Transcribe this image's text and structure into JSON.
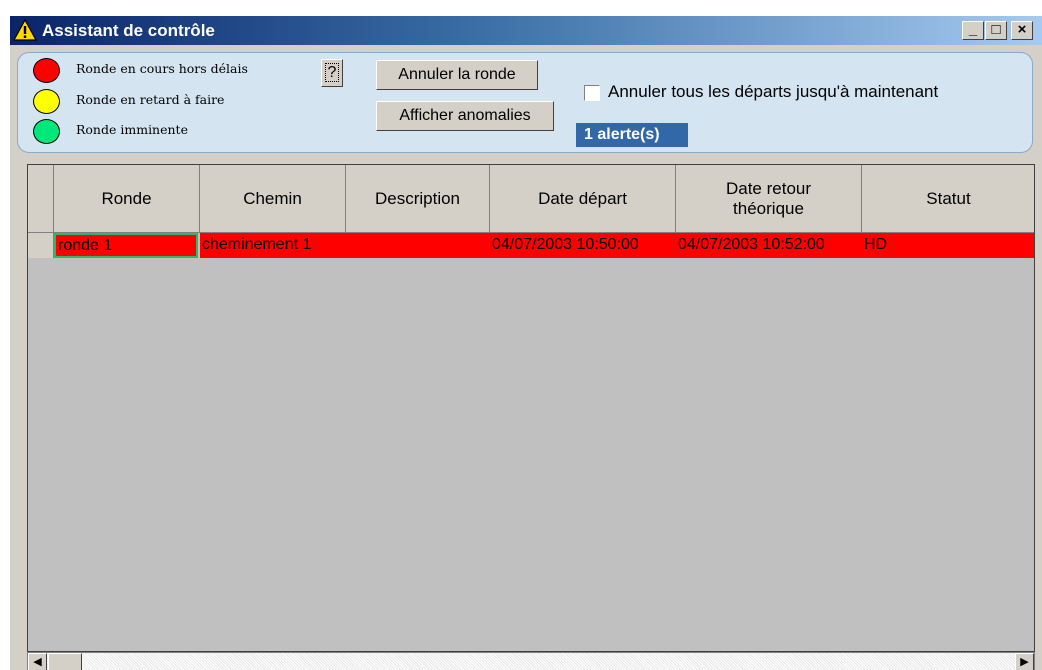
{
  "window": {
    "title": "Assistant de contrôle",
    "controls": {
      "minimize": "_",
      "maximize": "□",
      "close": "×"
    }
  },
  "legend": [
    {
      "label": "Ronde en cours hors délais",
      "color": "#ff0000"
    },
    {
      "label": "Ronde en retard à faire",
      "color": "#ffff00"
    },
    {
      "label": "Ronde imminente",
      "color": "#00e87a"
    }
  ],
  "toolbar": {
    "help_label": "?",
    "cancel_round_label": "Annuler la ronde",
    "show_anomalies_label": "Afficher anomalies",
    "cancel_all_label": "Annuler tous les départs jusqu'à maintenant",
    "cancel_all_checked": false,
    "alert_count": "1 alerte(s)"
  },
  "table": {
    "columns": [
      "Ronde",
      "Chemin",
      "Description",
      "Date départ",
      "Date retour\nthéorique",
      "Statut"
    ],
    "rows": [
      [
        "ronde 1",
        "cheminement 1",
        "",
        "04/07/2003 10:50:00",
        "04/07/2003 10:52:00",
        "HD"
      ]
    ],
    "row_color": "#ff0000"
  },
  "scrollbar": {
    "left_arrow": "◀",
    "right_arrow": "▶"
  }
}
